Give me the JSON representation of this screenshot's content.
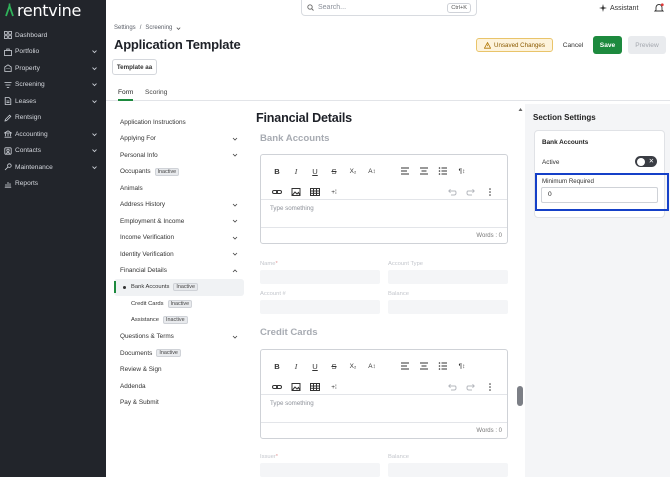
{
  "app": {
    "brand": "rentvine"
  },
  "sidebar": {
    "items": [
      {
        "label": "Dashboard",
        "icon": "grid-icon",
        "chevron": false
      },
      {
        "label": "Portfolio",
        "icon": "briefcase-icon",
        "chevron": true
      },
      {
        "label": "Property",
        "icon": "building-icon",
        "chevron": true
      },
      {
        "label": "Screening",
        "icon": "filter-icon",
        "chevron": true
      },
      {
        "label": "Leases",
        "icon": "document-icon",
        "chevron": true
      },
      {
        "label": "Rentsign",
        "icon": "pen-icon",
        "chevron": false
      },
      {
        "label": "Accounting",
        "icon": "bank-icon",
        "chevron": true
      },
      {
        "label": "Contacts",
        "icon": "contact-icon",
        "chevron": true
      },
      {
        "label": "Maintenance",
        "icon": "wrench-icon",
        "chevron": true
      },
      {
        "label": "Reports",
        "icon": "chart-icon",
        "chevron": false
      }
    ]
  },
  "topbar": {
    "search_placeholder": "Search...",
    "search_shortcut": "Ctrl+K",
    "assistant_label": "Assistant"
  },
  "header": {
    "breadcrumb": [
      "Settings",
      "/",
      "Screening"
    ],
    "title": "Application Template",
    "template_badge": "Template aa",
    "unsaved_label": "Unsaved Changes",
    "cancel_label": "Cancel",
    "save_label": "Save",
    "preview_label": "Preview"
  },
  "tabs": [
    {
      "label": "Form",
      "active": true
    },
    {
      "label": "Scoring",
      "active": false
    }
  ],
  "form_nav": {
    "items": [
      {
        "label": "Application Instructions"
      },
      {
        "label": "Applying For",
        "chevron": "down"
      },
      {
        "label": "Personal Info",
        "chevron": "down"
      },
      {
        "label": "Occupants",
        "badge": "Inactive"
      },
      {
        "label": "Animals"
      },
      {
        "label": "Address History",
        "chevron": "down"
      },
      {
        "label": "Employment & Income",
        "chevron": "down"
      },
      {
        "label": "Income Verification",
        "chevron": "down"
      },
      {
        "label": "Identity Verification",
        "chevron": "down"
      },
      {
        "label": "Financial Details",
        "chevron": "up"
      },
      {
        "label": "Bank Accounts",
        "badge": "Inactive",
        "sub": true,
        "active": true
      },
      {
        "label": "Credit Cards",
        "badge": "Inactive",
        "sub": true
      },
      {
        "label": "Assistance",
        "badge": "Inactive",
        "sub": true
      },
      {
        "label": "Questions & Terms",
        "chevron": "down"
      },
      {
        "label": "Documents",
        "badge": "Inactive"
      },
      {
        "label": "Review & Sign"
      },
      {
        "label": "Addenda"
      },
      {
        "label": "Pay & Submit"
      }
    ]
  },
  "main": {
    "title": "Financial Details",
    "bank_accounts": {
      "title": "Bank Accounts",
      "editor_placeholder": "Type something",
      "words": "Words : 0",
      "fields": {
        "name": "Name",
        "account_type": "Account Type",
        "account_no": "Account #",
        "balance": "Balance"
      }
    },
    "credit_cards": {
      "title": "Credit Cards",
      "editor_placeholder": "Type something",
      "words": "Words : 0",
      "fields": {
        "issuer": "Issuer",
        "balance": "Balance"
      }
    },
    "toolbar": {
      "bold": "B",
      "italic": "I",
      "underline": "U",
      "strike": "S",
      "subscript": "X₂",
      "text_size": "A↕",
      "paragraph": "¶↕",
      "insert": "+⁞"
    }
  },
  "section_settings": {
    "title": "Section Settings",
    "card_title": "Bank Accounts",
    "active_label": "Active",
    "active_toggle": false,
    "minimum_required_label": "Minimum Required",
    "minimum_required_value": "0"
  },
  "colors": {
    "sidebar_bg": "#22252b",
    "accent_green": "#1d8a3e",
    "highlight_blue": "#1540c8",
    "warning_bg": "#fdf3dc"
  }
}
